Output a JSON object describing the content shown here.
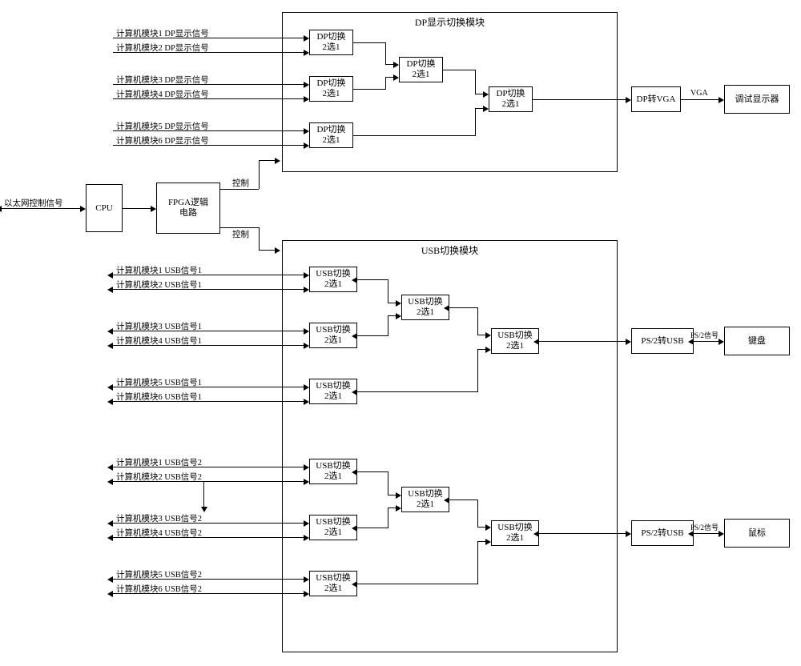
{
  "ext": {
    "ethernet_label": "以太网控制信号",
    "cpu": "CPU",
    "fpga": "FPGA逻辑\n电路",
    "ctrl1": "控制",
    "ctrl2": "控制"
  },
  "dp": {
    "module_title": "DP显示切换模块",
    "inputs": [
      "计算机模块1 DP显示信号",
      "计算机模块2 DP显示信号",
      "计算机模块3 DP显示信号",
      "计算机模块4 DP显示信号",
      "计算机模块5 DP显示信号",
      "计算机模块6 DP显示信号"
    ],
    "sw_l1": "DP切换",
    "sw_l2": "2选1",
    "dp2vga": "DP转VGA",
    "vga_label": "VGA",
    "monitor": "调试显示器"
  },
  "usb": {
    "module_title": "USB切换模块",
    "inputs1": [
      "计算机模块1 USB信号1",
      "计算机模块2 USB信号1",
      "计算机模块3 USB信号1",
      "计算机模块4 USB信号1",
      "计算机模块5 USB信号1",
      "计算机模块6 USB信号1"
    ],
    "inputs2": [
      "计算机模块1 USB信号2",
      "计算机模块2 USB信号2",
      "计算机模块3 USB信号2",
      "计算机模块4 USB信号2",
      "计算机模块5 USB信号2",
      "计算机模块6 USB信号2"
    ],
    "sw_l1": "USB切换",
    "sw_l2": "2选1",
    "ps2usb": "PS/2转USB",
    "ps2_label": "PS/2信号",
    "keyboard": "键盘",
    "mouse": "鼠标"
  }
}
